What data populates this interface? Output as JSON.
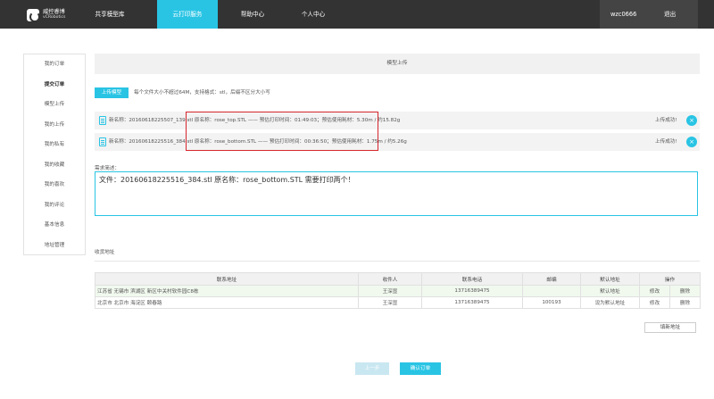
{
  "brand": {
    "name_cn": "威控睿博",
    "name_en": "vCRobotics"
  },
  "nav": [
    {
      "label": "共享模型库",
      "active": false
    },
    {
      "label": "云打印服务",
      "active": true
    },
    {
      "label": "帮助中心",
      "active": false
    },
    {
      "label": "个人中心",
      "active": false
    }
  ],
  "user": {
    "name": "wzc0666",
    "logout": "退出"
  },
  "sidebar": {
    "items": [
      {
        "label": "我的订单"
      },
      {
        "label": "提交订单"
      },
      {
        "label": "模型上传"
      },
      {
        "label": "我的上传"
      },
      {
        "label": "我的私有"
      },
      {
        "label": "我的收藏"
      },
      {
        "label": "我的喜欢"
      },
      {
        "label": "我的评论"
      },
      {
        "label": "基本信息"
      },
      {
        "label": "地址管理"
      }
    ]
  },
  "main": {
    "title": "模型上传",
    "upload_button": "上传模型",
    "upload_note": "每个文件大小不超过64M，支持格式：stl，后缀不区分大小写",
    "files": [
      {
        "text": "新名称：20160618225507_139.stl 原名称：rose_top.STL —— 预估打印时间：01:49:03；预估使用耗材：5.30m / 约15.82g",
        "status": "上传成功!"
      },
      {
        "text": "新名称：20160618225516_384.stl 原名称：rose_bottom.STL —— 预估打印时间：00:36:50；预估使用耗材：1.75m / 约5.26g",
        "status": "上传成功!"
      }
    ],
    "requirement_label": "需求简述：",
    "requirement_text": "文件：20160618225516_384.stl 原名称：rose_bottom.STL 需要打印两个！",
    "address_label": "收货地址",
    "address_table": {
      "headers": [
        "联系地址",
        "收件人",
        "联系电话",
        "邮编",
        "默认地址",
        "操作"
      ],
      "rows": [
        {
          "address": "江苏省 无锡市 滨湖区 新区中关村软件园C8栋",
          "recipient": "王深显",
          "phone": "13716389475",
          "zip": "",
          "default": "默认地址",
          "edit": "修改",
          "delete": "删除"
        },
        {
          "address": "北京市 北京市 海淀区 颐春路",
          "recipient": "王深显",
          "phone": "13716389475",
          "zip": "100193",
          "default": "设为默认地址",
          "edit": "修改",
          "delete": "删除"
        }
      ]
    },
    "add_address_button": "填新地址",
    "prev_button": "上一步",
    "confirm_button": "确认订单"
  },
  "colors": {
    "accent": "#29c4e4",
    "topbar": "#333333",
    "highlight": "#d6262c"
  }
}
